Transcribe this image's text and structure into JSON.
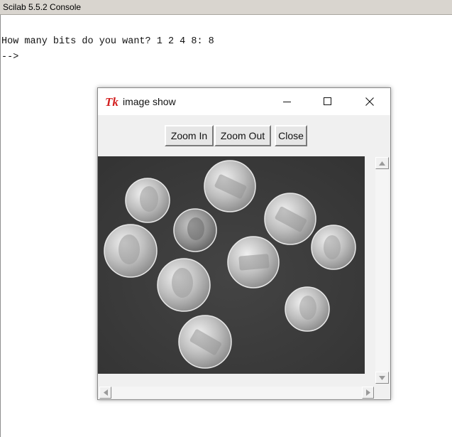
{
  "console": {
    "title": "Scilab 5.5.2 Console",
    "lines": [
      "How many bits do you want? 1 2 4 8: 8",
      "-->"
    ]
  },
  "image_window": {
    "title": "image show",
    "logo_text": "Tk",
    "buttons": {
      "zoom_in": "Zoom In",
      "zoom_out": "Zoom Out",
      "close": "Close"
    },
    "image_description": "grayscale photo of coins on dark background",
    "icons": {
      "minimize": "minimize-icon",
      "maximize": "maximize-icon",
      "close": "close-icon",
      "scroll_up": "arrow-up-icon",
      "scroll_down": "arrow-down-icon",
      "scroll_left": "arrow-left-icon",
      "scroll_right": "arrow-right-icon"
    }
  },
  "colors": {
    "titlebar": "#d9d5cf",
    "logo_red": "#d32020",
    "image_background": "#3d3d3d"
  }
}
